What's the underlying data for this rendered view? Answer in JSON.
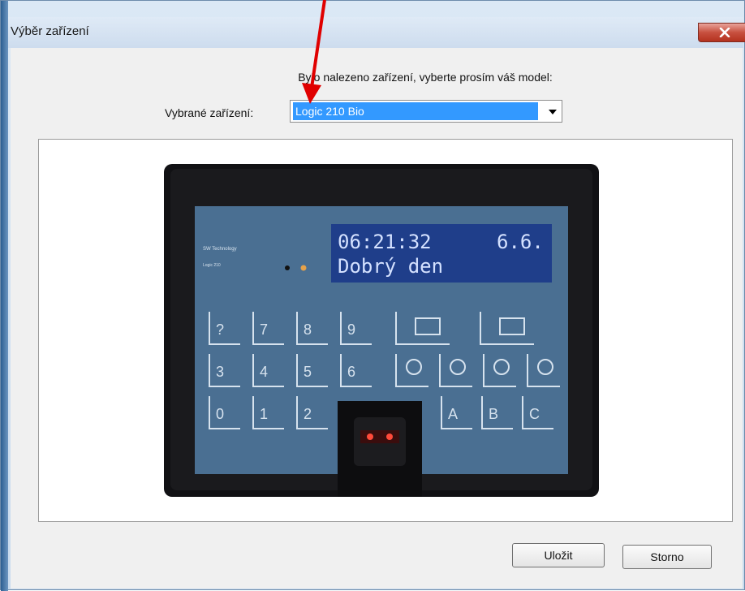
{
  "window": {
    "title": "Výběr zařízení",
    "close_glyph": "x"
  },
  "dialog": {
    "prompt": "Bylo nalezeno zařízení, vyberte prosím váš model:",
    "selected_label": "Vybrané zařízení:",
    "selected_value": "Logic 210 Bio"
  },
  "device": {
    "brand_line": "SW Technology",
    "model_line": "Logic 210",
    "lcd_time": "06:21:32",
    "lcd_date": "6.6.",
    "lcd_message": "Dobrý den",
    "keys_row1": [
      "?",
      "7",
      "8",
      "9"
    ],
    "keys_row2": [
      "3",
      "4",
      "5",
      "6"
    ],
    "keys_row3": [
      "0",
      "1",
      "2"
    ],
    "letter_keys": [
      "A",
      "B",
      "C"
    ]
  },
  "buttons": {
    "save": "Uložit",
    "cancel": "Storno"
  },
  "colors": {
    "selection": "#3399ff",
    "annotation_arrow": "#e00000",
    "lcd_background": "#1f3e8a"
  }
}
